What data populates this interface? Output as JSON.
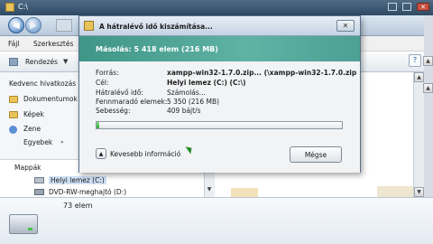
{
  "explorer": {
    "address": "C:\\",
    "menu": {
      "organize": "Fájl",
      "share": "Szerkesztés"
    },
    "toolbar": {
      "organize_label": "Rendezés"
    },
    "favorites": {
      "heading": "Kedvenc hivatkozás",
      "items": [
        "Dokumentumok",
        "Képek",
        "Zene"
      ],
      "more": "Egyebek"
    },
    "folders": {
      "heading": "Mappák",
      "items": [
        "Helyi lemez (C:)",
        "DVD-RW-meghajtó (D:)"
      ]
    },
    "status": {
      "count": "73 elem"
    }
  },
  "dialog": {
    "title": "A hátralévő idő kiszámítása...",
    "header": "Másolás: 5 418 elem (216 MB)",
    "rows": [
      {
        "label": "Forrás:",
        "value": "xampp-win32-1.7.0.zip... (\\xampp-win32-1.7.0.zip"
      },
      {
        "label": "Cél:",
        "value": "Helyi lemez (C:) (C:\\)"
      },
      {
        "label": "Hátralévő idő:",
        "value": "Számolás..."
      },
      {
        "label": "Fennmaradó elemek:",
        "value": "5 350 (216 MB)"
      },
      {
        "label": "Sebesség:",
        "value": "409 bájt/s"
      }
    ],
    "progress": 0.01,
    "less_info_label": "Kevesebb információ",
    "cancel_label": "Mégse"
  }
}
